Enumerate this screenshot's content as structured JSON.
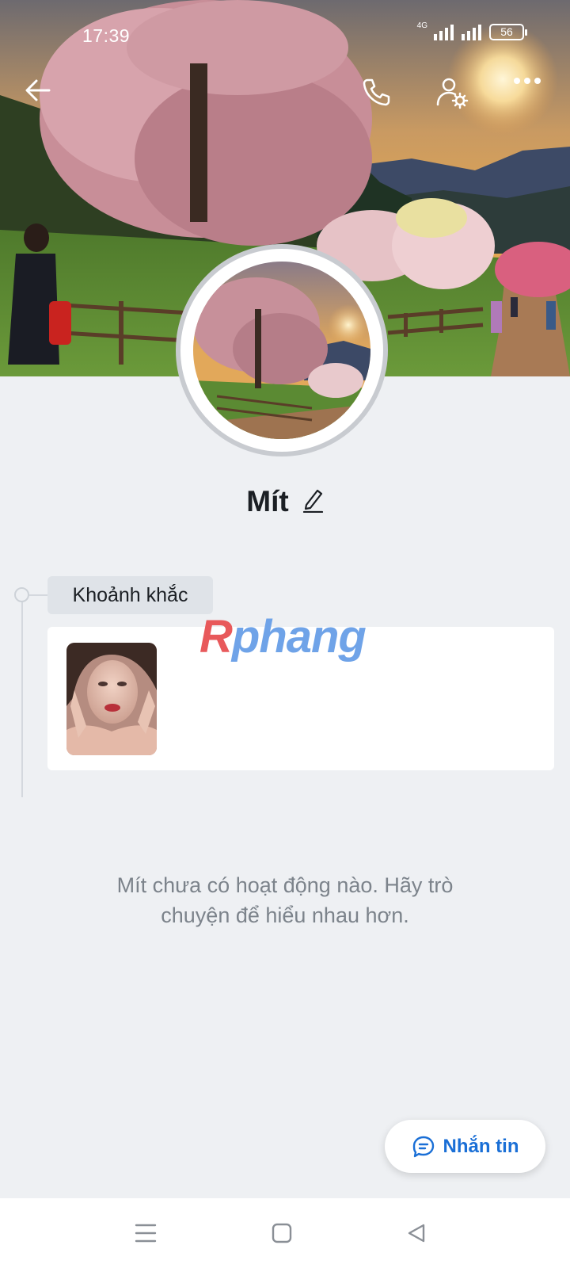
{
  "status_bar": {
    "time": "17:39",
    "network": "4G",
    "battery": "56"
  },
  "top_bar": {
    "back_icon": "arrow-left-icon",
    "call_icon": "phone-icon",
    "settings_icon": "user-settings-icon",
    "more_icon": "more-horizontal-icon"
  },
  "profile": {
    "name": "Mít",
    "edit_icon": "pencil-icon"
  },
  "moments": {
    "label": "Khoảnh khắc"
  },
  "watermark": {
    "first_letter": "R",
    "rest": "phang"
  },
  "empty_state": {
    "text": "Mít chưa có hoạt động nào. Hãy trò chuyện để hiểu nhau hơn."
  },
  "message_button": {
    "label": "Nhắn tin",
    "icon": "chat-bubble-icon",
    "color": "#1a6fd6"
  },
  "nav_bar": {
    "menu_icon": "menu-icon",
    "home_icon": "square-home-icon",
    "back_icon": "triangle-back-icon"
  }
}
